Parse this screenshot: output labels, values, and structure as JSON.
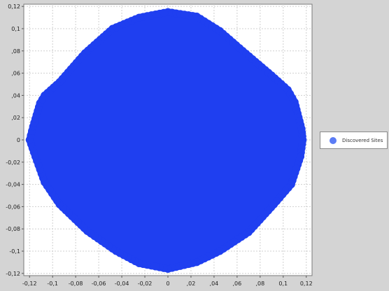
{
  "chart_data": {
    "type": "scatter",
    "title": "",
    "xlabel": "",
    "ylabel": "",
    "xlim": [
      -0.125,
      0.125
    ],
    "ylim": [
      -0.122,
      0.122
    ],
    "grid": true,
    "legend_position": "right",
    "x_ticks": [
      {
        "value": -0.12,
        "label": "-0,12"
      },
      {
        "value": -0.1,
        "label": "-0,1"
      },
      {
        "value": -0.08,
        "label": "-0,08"
      },
      {
        "value": -0.06,
        "label": "-0,06"
      },
      {
        "value": -0.04,
        "label": "-0,04"
      },
      {
        "value": -0.02,
        "label": "-0,02"
      },
      {
        "value": 0.0,
        "label": "0"
      },
      {
        "value": 0.02,
        "label": ",02"
      },
      {
        "value": 0.04,
        "label": ",04"
      },
      {
        "value": 0.06,
        "label": ",06"
      },
      {
        "value": 0.08,
        "label": ",08"
      },
      {
        "value": 0.1,
        "label": "0,1"
      },
      {
        "value": 0.12,
        "label": "0,12"
      }
    ],
    "y_ticks": [
      {
        "value": 0.12,
        "label": "0,12"
      },
      {
        "value": 0.1,
        "label": "0,1"
      },
      {
        "value": 0.08,
        "label": ",08"
      },
      {
        "value": 0.06,
        "label": ",06"
      },
      {
        "value": 0.04,
        "label": ",04"
      },
      {
        "value": 0.02,
        "label": ",02"
      },
      {
        "value": 0.0,
        "label": "0"
      },
      {
        "value": -0.02,
        "label": "-0,02"
      },
      {
        "value": -0.04,
        "label": "-0,04"
      },
      {
        "value": -0.06,
        "label": "-0,06"
      },
      {
        "value": -0.08,
        "label": "-0,08"
      },
      {
        "value": -0.1,
        "label": "-0,1"
      },
      {
        "value": -0.12,
        "label": "-0,12"
      }
    ],
    "series": [
      {
        "name": "Discovered Sites",
        "color": "#1f3ff0",
        "legend_color": "#5b7cf5",
        "marker": "circle",
        "extent_polygon": [
          [
            0.0,
            0.115
          ],
          [
            0.025,
            0.111
          ],
          [
            0.045,
            0.098
          ],
          [
            0.065,
            0.08
          ],
          [
            0.09,
            0.058
          ],
          [
            0.104,
            0.045
          ],
          [
            0.11,
            0.034
          ],
          [
            0.116,
            0.01
          ],
          [
            0.117,
            0.0
          ],
          [
            0.115,
            -0.015
          ],
          [
            0.107,
            -0.04
          ],
          [
            0.092,
            -0.058
          ],
          [
            0.07,
            -0.083
          ],
          [
            0.045,
            -0.1
          ],
          [
            0.025,
            -0.11
          ],
          [
            0.0,
            -0.116
          ],
          [
            -0.025,
            -0.111
          ],
          [
            -0.045,
            -0.1
          ],
          [
            -0.07,
            -0.082
          ],
          [
            -0.094,
            -0.058
          ],
          [
            -0.107,
            -0.038
          ],
          [
            -0.115,
            -0.015
          ],
          [
            -0.12,
            0.0
          ],
          [
            -0.117,
            0.012
          ],
          [
            -0.111,
            0.033
          ],
          [
            -0.107,
            0.04
          ],
          [
            -0.094,
            0.052
          ],
          [
            -0.072,
            0.078
          ],
          [
            -0.048,
            0.1
          ],
          [
            -0.025,
            0.11
          ],
          [
            0.0,
            0.115
          ]
        ]
      }
    ]
  }
}
